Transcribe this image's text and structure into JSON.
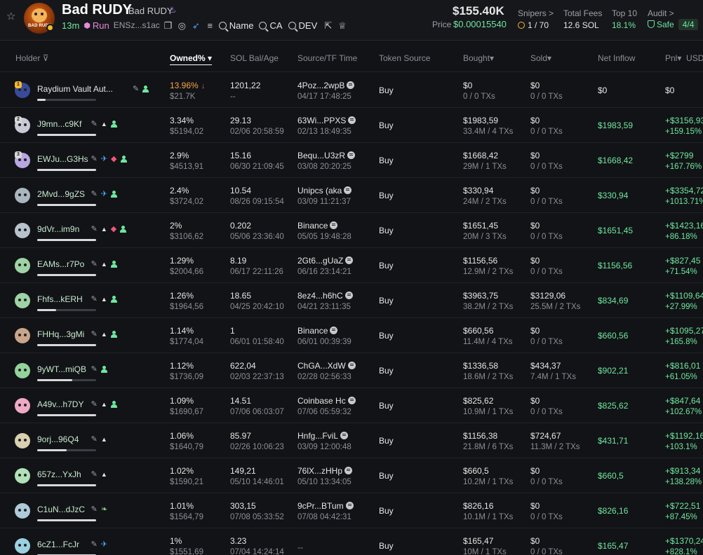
{
  "header": {
    "token_name": "Bad RUDY",
    "token_symbol": "Bad RUDY",
    "logo_text": "BAD RUDY",
    "age": "13m",
    "run_label": "Run",
    "contract_short": "ENSz...s1ac",
    "search_name": "Name",
    "search_ca": "CA",
    "search_dev": "DEV",
    "market_cap": "$155.40K",
    "price_label": "Price",
    "price_value": "$0.00015540",
    "snipers_label": "Snipers >",
    "snipers_value": "1 / 70",
    "fees_label": "Total Fees",
    "fees_value": "12.6 SOL",
    "top10_label": "Top 10",
    "top10_value": "18.1%",
    "audit_label": "Audit >",
    "audit_value": "Safe",
    "audit_score": "4/4"
  },
  "columns": {
    "holder": "Holder",
    "owned": "Owned%",
    "sol_age": "SOL Bal/Age",
    "source_tf": "Source/TF Time",
    "token_source": "Token Source",
    "bought": "Bought",
    "sold": "Sold",
    "net_inflow": "Net Inflow",
    "pnl": "Pnl",
    "usd": "USD"
  },
  "rows": [
    {
      "rank": "1",
      "name": "Raydium Vault Aut...",
      "owned": "13.96%",
      "owned_usd": "$21.7K",
      "sol": "1201,22",
      "age": "--",
      "source": "4Poz...2wpB",
      "tf_time": "04/17 17:48:25",
      "token_source": "Buy",
      "bought": "$0",
      "bought_sub": "0 / 0 TXs",
      "sold": "$0",
      "sold_sub": "0 / 0 TXs",
      "inflow": "$0",
      "pnl": "$0",
      "pnl_pct": "",
      "bar": 0.14
    },
    {
      "rank": "2",
      "name": "J9mn...c9Kf",
      "owned": "3.34%",
      "owned_usd": "$5194,02",
      "sol": "29.13",
      "age": "02/06 20:58:59",
      "source": "63Wi...PPXS",
      "tf_time": "02/13 18:49:35",
      "token_source": "Buy",
      "bought": "$1983,59",
      "bought_sub": "33.4M / 4 TXs",
      "sold": "$0",
      "sold_sub": "0 / 0 TXs",
      "inflow": "$1983,59",
      "pnl": "+$3156,93",
      "pnl_pct": "+159.15%",
      "bar": 1.0
    },
    {
      "rank": "3",
      "name": "EWJu...G3Hs",
      "owned": "2.9%",
      "owned_usd": "$4513,91",
      "sol": "15.16",
      "age": "06/30 21:09:45",
      "source": "Bequ...U3zR",
      "tf_time": "03/08 20:20:25",
      "token_source": "Buy",
      "bought": "$1668,42",
      "bought_sub": "29M / 1 TXs",
      "sold": "$0",
      "sold_sub": "0 / 0 TXs",
      "inflow": "$1668,42",
      "pnl": "+$2799",
      "pnl_pct": "+167.76%",
      "bar": 1.0
    },
    {
      "rank": "",
      "name": "2Mvd...9gZS",
      "owned": "2.4%",
      "owned_usd": "$3724,02",
      "sol": "10.54",
      "age": "08/26 09:15:54",
      "source": "Unipcs (aka",
      "tf_time": "03/09 11:21:37",
      "token_source": "Buy",
      "bought": "$330,94",
      "bought_sub": "24M / 2 TXs",
      "sold": "$0",
      "sold_sub": "0 / 0 TXs",
      "inflow": "$330,94",
      "pnl": "+$3354,72",
      "pnl_pct": "+1013.71%",
      "bar": 1.0
    },
    {
      "rank": "",
      "name": "9dVr...im9n",
      "owned": "2%",
      "owned_usd": "$3106,62",
      "sol": "0.202",
      "age": "05/06 23:36:40",
      "source": "Binance",
      "tf_time": "05/05 19:48:28",
      "token_source": "Buy",
      "bought": "$1651,45",
      "bought_sub": "20M / 3 TXs",
      "sold": "$0",
      "sold_sub": "0 / 0 TXs",
      "inflow": "$1651,45",
      "pnl": "+$1423,16",
      "pnl_pct": "+86.18%",
      "bar": 1.0
    },
    {
      "rank": "",
      "name": "EAMs...r7Po",
      "owned": "1.29%",
      "owned_usd": "$2004,66",
      "sol": "8.19",
      "age": "06/17 22:11:26",
      "source": "2Gt6...gUaZ",
      "tf_time": "06/16 23:14:21",
      "token_source": "Buy",
      "bought": "$1156,56",
      "bought_sub": "12.9M / 2 TXs",
      "sold": "$0",
      "sold_sub": "0 / 0 TXs",
      "inflow": "$1156,56",
      "pnl": "+$827,45",
      "pnl_pct": "+71.54%",
      "bar": 1.0
    },
    {
      "rank": "",
      "name": "Fhfs...kERH",
      "owned": "1.26%",
      "owned_usd": "$1964,56",
      "sol": "18.65",
      "age": "04/25 20:42:10",
      "source": "8ez4...h6hC",
      "tf_time": "04/21 23:11:35",
      "token_source": "Buy",
      "bought": "$3963,75",
      "bought_sub": "38.2M / 2 TXs",
      "sold": "$3129,06",
      "sold_sub": "25.5M / 2 TXs",
      "inflow": "$834,69",
      "pnl": "+$1109,64",
      "pnl_pct": "+27.99%",
      "bar": 0.32
    },
    {
      "rank": "",
      "name": "FHHq...3gMi",
      "owned": "1.14%",
      "owned_usd": "$1774,04",
      "sol": "1",
      "age": "06/01 01:58:40",
      "source": "Binance",
      "tf_time": "06/01 00:39:39",
      "token_source": "Buy",
      "bought": "$660,56",
      "bought_sub": "11.4M / 4 TXs",
      "sold": "$0",
      "sold_sub": "0 / 0 TXs",
      "inflow": "$660,56",
      "pnl": "+$1095,27",
      "pnl_pct": "+165.8%",
      "bar": 1.0
    },
    {
      "rank": "",
      "name": "9yWT...miQB",
      "owned": "1.12%",
      "owned_usd": "$1736,09",
      "sol": "622,04",
      "age": "02/03 22:37:13",
      "source": "ChGA...XdW",
      "tf_time": "02/28 02:56:33",
      "token_source": "Buy",
      "bought": "$1336,58",
      "bought_sub": "18.6M / 2 TXs",
      "sold": "$434,37",
      "sold_sub": "7.4M / 1 TXs",
      "inflow": "$902,21",
      "pnl": "+$816,01",
      "pnl_pct": "+61.05%",
      "bar": 0.6
    },
    {
      "rank": "",
      "name": "A49v...h7DY",
      "owned": "1.09%",
      "owned_usd": "$1690,67",
      "sol": "14.51",
      "age": "07/06 06:03:07",
      "source": "Coinbase Hc",
      "tf_time": "07/06 05:59:32",
      "token_source": "Buy",
      "bought": "$825,62",
      "bought_sub": "10.9M / 1 TXs",
      "sold": "$0",
      "sold_sub": "0 / 0 TXs",
      "inflow": "$825,62",
      "pnl": "+$847,64",
      "pnl_pct": "+102.67%",
      "bar": 1.0
    },
    {
      "rank": "",
      "name": "9orj...96Q4",
      "owned": "1.06%",
      "owned_usd": "$1640,79",
      "sol": "85.97",
      "age": "02/26 10:06:23",
      "source": "Hnfg...FviL",
      "tf_time": "03/09 12:00:48",
      "token_source": "Buy",
      "bought": "$1156,38",
      "bought_sub": "21.8M / 6 TXs",
      "sold": "$724,67",
      "sold_sub": "11.3M / 2 TXs",
      "inflow": "$431,71",
      "pnl": "+$1192,16",
      "pnl_pct": "+103.1%",
      "bar": 0.5
    },
    {
      "rank": "",
      "name": "657z...YxJh",
      "owned": "1.02%",
      "owned_usd": "$1590,21",
      "sol": "149,21",
      "age": "05/10 14:46:01",
      "source": "76lX...zHHp",
      "tf_time": "05/10 13:34:05",
      "token_source": "Buy",
      "bought": "$660,5",
      "bought_sub": "10.2M / 1 TXs",
      "sold": "$0",
      "sold_sub": "0 / 0 TXs",
      "inflow": "$660,5",
      "pnl": "+$913,34",
      "pnl_pct": "+138.28%",
      "bar": 1.0
    },
    {
      "rank": "",
      "name": "C1uN...dJzC",
      "owned": "1.01%",
      "owned_usd": "$1564,79",
      "sol": "303,15",
      "age": "07/08 05:33:52",
      "source": "9cPr...BTum",
      "tf_time": "07/08 04:42:31",
      "token_source": "Buy",
      "bought": "$826,16",
      "bought_sub": "10.1M / 1 TXs",
      "sold": "$0",
      "sold_sub": "0 / 0 TXs",
      "inflow": "$826,16",
      "pnl": "+$722,51",
      "pnl_pct": "+87.45%",
      "bar": 1.0
    },
    {
      "rank": "",
      "name": "6cZ1...FcJr",
      "owned": "1%",
      "owned_usd": "$1551,69",
      "sol": "3.23",
      "age": "07/04 14:24:14",
      "source": "--",
      "tf_time": "",
      "token_source": "Buy",
      "bought": "$165,47",
      "bought_sub": "10M / 1 TXs",
      "sold": "$0",
      "sold_sub": "0 / 0 TXs",
      "inflow": "$165,47",
      "pnl": "+$1370,24",
      "pnl_pct": "+828.1%",
      "bar": 1.0
    }
  ],
  "colors": {
    "green": "#6ee7a0",
    "orange": "#f5a742",
    "red": "#f2557a",
    "bg": "#121316"
  }
}
